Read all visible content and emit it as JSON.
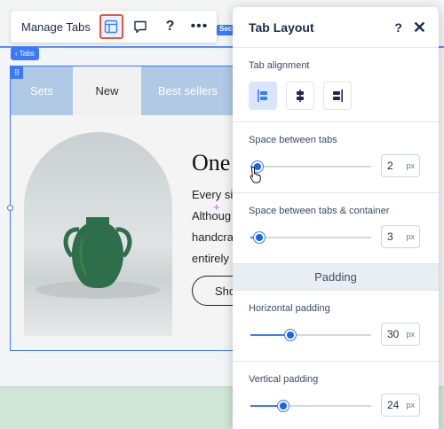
{
  "toolbar": {
    "manage_tabs_label": "Manage Tabs",
    "help_label": "?",
    "more_label": "•••"
  },
  "canvas": {
    "tabs_badge": "‹ Tabs",
    "section_badge": "Sec"
  },
  "widget": {
    "tabs": [
      {
        "label": "Sets"
      },
      {
        "label": "New"
      },
      {
        "label": "Best sellers"
      }
    ],
    "title": "One",
    "lines": [
      "Every si",
      "Althoug",
      "handcra",
      "entirely"
    ],
    "button_label": "Sho"
  },
  "panel": {
    "title": "Tab Layout",
    "help": "?",
    "close": "✕",
    "tab_alignment": {
      "label": "Tab alignment",
      "options": [
        "align-left",
        "align-center",
        "align-right"
      ],
      "selected": "align-left"
    },
    "space_between_tabs": {
      "label": "Space between tabs",
      "value": "2",
      "unit": "px",
      "fraction": 0.06
    },
    "space_tabs_container": {
      "label": "Space between tabs & container",
      "value": "3",
      "unit": "px",
      "fraction": 0.07
    },
    "padding_header": "Padding",
    "horizontal_padding": {
      "label": "Horizontal padding",
      "value": "30",
      "unit": "px",
      "fraction": 0.33
    },
    "vertical_padding": {
      "label": "Vertical padding",
      "value": "24",
      "unit": "px",
      "fraction": 0.27
    }
  },
  "colors": {
    "accent": "#3b7bfb",
    "tab_bg": "#b0c9e4",
    "active_outline": "#e8553d",
    "vase": "#2f6e4a"
  }
}
